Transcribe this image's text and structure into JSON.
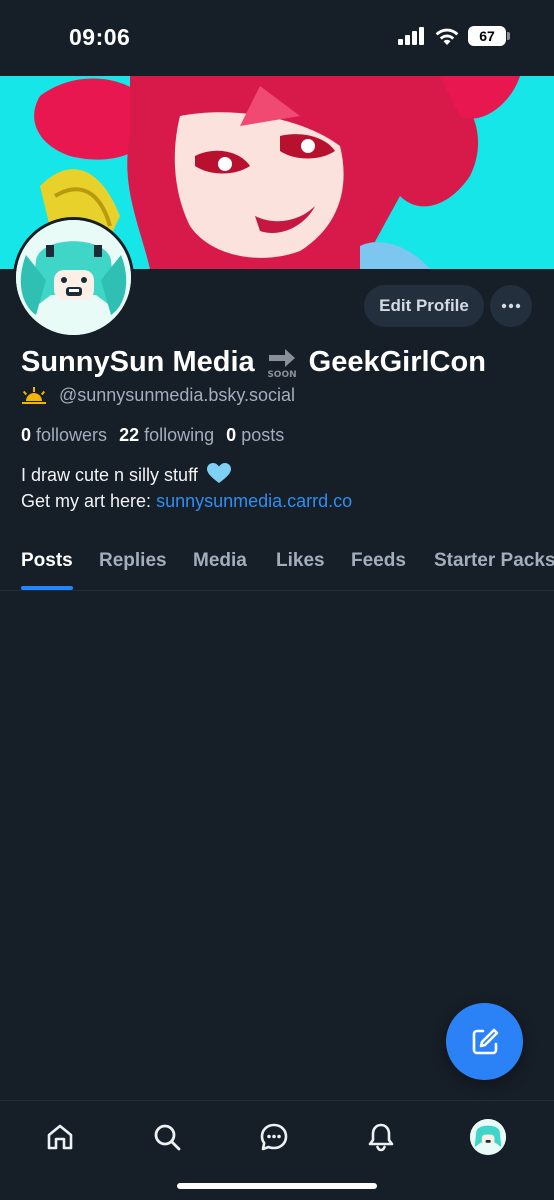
{
  "status": {
    "time": "09:06",
    "battery": "67"
  },
  "profile": {
    "display_name_part1": "SunnySun Media",
    "display_name_part2": "GeekGirlCon",
    "handle": "@sunnysunmedia.bsky.social",
    "followers_count": "0",
    "followers_label": "followers",
    "following_count": "22",
    "following_label": "following",
    "posts_count": "0",
    "posts_label": "posts",
    "bio_line1": "I draw cute n silly stuff",
    "bio_line2_prefix": "Get my art here:",
    "bio_link": "sunnysunmedia.carrd.co",
    "edit_profile_label": "Edit Profile"
  },
  "tabs": [
    {
      "label": "Posts",
      "active": true
    },
    {
      "label": "Replies"
    },
    {
      "label": "Media"
    },
    {
      "label": "Likes"
    },
    {
      "label": "Feeds"
    },
    {
      "label": "Starter Packs"
    }
  ],
  "bottom_nav": [
    "home-icon",
    "search-icon",
    "chat-icon",
    "bell-icon",
    "profile-avatar"
  ],
  "colors": {
    "background": "#161e27",
    "accent": "#2087ff",
    "banner": "#16e6e8",
    "link": "#2d8fef"
  }
}
